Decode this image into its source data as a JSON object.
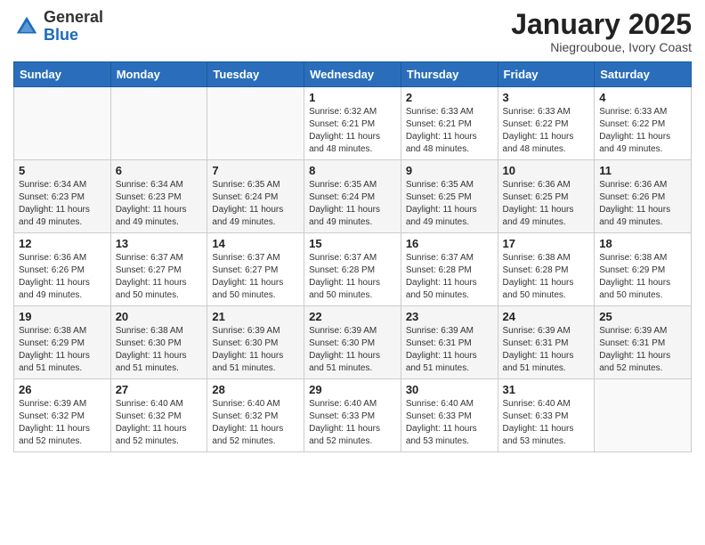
{
  "logo": {
    "text_general": "General",
    "text_blue": "Blue"
  },
  "header": {
    "month": "January 2025",
    "location": "Niegrouboue, Ivory Coast"
  },
  "days_of_week": [
    "Sunday",
    "Monday",
    "Tuesday",
    "Wednesday",
    "Thursday",
    "Friday",
    "Saturday"
  ],
  "weeks": [
    [
      {
        "day": "",
        "info": ""
      },
      {
        "day": "",
        "info": ""
      },
      {
        "day": "",
        "info": ""
      },
      {
        "day": "1",
        "info": "Sunrise: 6:32 AM\nSunset: 6:21 PM\nDaylight: 11 hours\nand 48 minutes."
      },
      {
        "day": "2",
        "info": "Sunrise: 6:33 AM\nSunset: 6:21 PM\nDaylight: 11 hours\nand 48 minutes."
      },
      {
        "day": "3",
        "info": "Sunrise: 6:33 AM\nSunset: 6:22 PM\nDaylight: 11 hours\nand 48 minutes."
      },
      {
        "day": "4",
        "info": "Sunrise: 6:33 AM\nSunset: 6:22 PM\nDaylight: 11 hours\nand 49 minutes."
      }
    ],
    [
      {
        "day": "5",
        "info": "Sunrise: 6:34 AM\nSunset: 6:23 PM\nDaylight: 11 hours\nand 49 minutes."
      },
      {
        "day": "6",
        "info": "Sunrise: 6:34 AM\nSunset: 6:23 PM\nDaylight: 11 hours\nand 49 minutes."
      },
      {
        "day": "7",
        "info": "Sunrise: 6:35 AM\nSunset: 6:24 PM\nDaylight: 11 hours\nand 49 minutes."
      },
      {
        "day": "8",
        "info": "Sunrise: 6:35 AM\nSunset: 6:24 PM\nDaylight: 11 hours\nand 49 minutes."
      },
      {
        "day": "9",
        "info": "Sunrise: 6:35 AM\nSunset: 6:25 PM\nDaylight: 11 hours\nand 49 minutes."
      },
      {
        "day": "10",
        "info": "Sunrise: 6:36 AM\nSunset: 6:25 PM\nDaylight: 11 hours\nand 49 minutes."
      },
      {
        "day": "11",
        "info": "Sunrise: 6:36 AM\nSunset: 6:26 PM\nDaylight: 11 hours\nand 49 minutes."
      }
    ],
    [
      {
        "day": "12",
        "info": "Sunrise: 6:36 AM\nSunset: 6:26 PM\nDaylight: 11 hours\nand 49 minutes."
      },
      {
        "day": "13",
        "info": "Sunrise: 6:37 AM\nSunset: 6:27 PM\nDaylight: 11 hours\nand 50 minutes."
      },
      {
        "day": "14",
        "info": "Sunrise: 6:37 AM\nSunset: 6:27 PM\nDaylight: 11 hours\nand 50 minutes."
      },
      {
        "day": "15",
        "info": "Sunrise: 6:37 AM\nSunset: 6:28 PM\nDaylight: 11 hours\nand 50 minutes."
      },
      {
        "day": "16",
        "info": "Sunrise: 6:37 AM\nSunset: 6:28 PM\nDaylight: 11 hours\nand 50 minutes."
      },
      {
        "day": "17",
        "info": "Sunrise: 6:38 AM\nSunset: 6:28 PM\nDaylight: 11 hours\nand 50 minutes."
      },
      {
        "day": "18",
        "info": "Sunrise: 6:38 AM\nSunset: 6:29 PM\nDaylight: 11 hours\nand 50 minutes."
      }
    ],
    [
      {
        "day": "19",
        "info": "Sunrise: 6:38 AM\nSunset: 6:29 PM\nDaylight: 11 hours\nand 51 minutes."
      },
      {
        "day": "20",
        "info": "Sunrise: 6:38 AM\nSunset: 6:30 PM\nDaylight: 11 hours\nand 51 minutes."
      },
      {
        "day": "21",
        "info": "Sunrise: 6:39 AM\nSunset: 6:30 PM\nDaylight: 11 hours\nand 51 minutes."
      },
      {
        "day": "22",
        "info": "Sunrise: 6:39 AM\nSunset: 6:30 PM\nDaylight: 11 hours\nand 51 minutes."
      },
      {
        "day": "23",
        "info": "Sunrise: 6:39 AM\nSunset: 6:31 PM\nDaylight: 11 hours\nand 51 minutes."
      },
      {
        "day": "24",
        "info": "Sunrise: 6:39 AM\nSunset: 6:31 PM\nDaylight: 11 hours\nand 51 minutes."
      },
      {
        "day": "25",
        "info": "Sunrise: 6:39 AM\nSunset: 6:31 PM\nDaylight: 11 hours\nand 52 minutes."
      }
    ],
    [
      {
        "day": "26",
        "info": "Sunrise: 6:39 AM\nSunset: 6:32 PM\nDaylight: 11 hours\nand 52 minutes."
      },
      {
        "day": "27",
        "info": "Sunrise: 6:40 AM\nSunset: 6:32 PM\nDaylight: 11 hours\nand 52 minutes."
      },
      {
        "day": "28",
        "info": "Sunrise: 6:40 AM\nSunset: 6:32 PM\nDaylight: 11 hours\nand 52 minutes."
      },
      {
        "day": "29",
        "info": "Sunrise: 6:40 AM\nSunset: 6:33 PM\nDaylight: 11 hours\nand 52 minutes."
      },
      {
        "day": "30",
        "info": "Sunrise: 6:40 AM\nSunset: 6:33 PM\nDaylight: 11 hours\nand 53 minutes."
      },
      {
        "day": "31",
        "info": "Sunrise: 6:40 AM\nSunset: 6:33 PM\nDaylight: 11 hours\nand 53 minutes."
      },
      {
        "day": "",
        "info": ""
      }
    ]
  ]
}
